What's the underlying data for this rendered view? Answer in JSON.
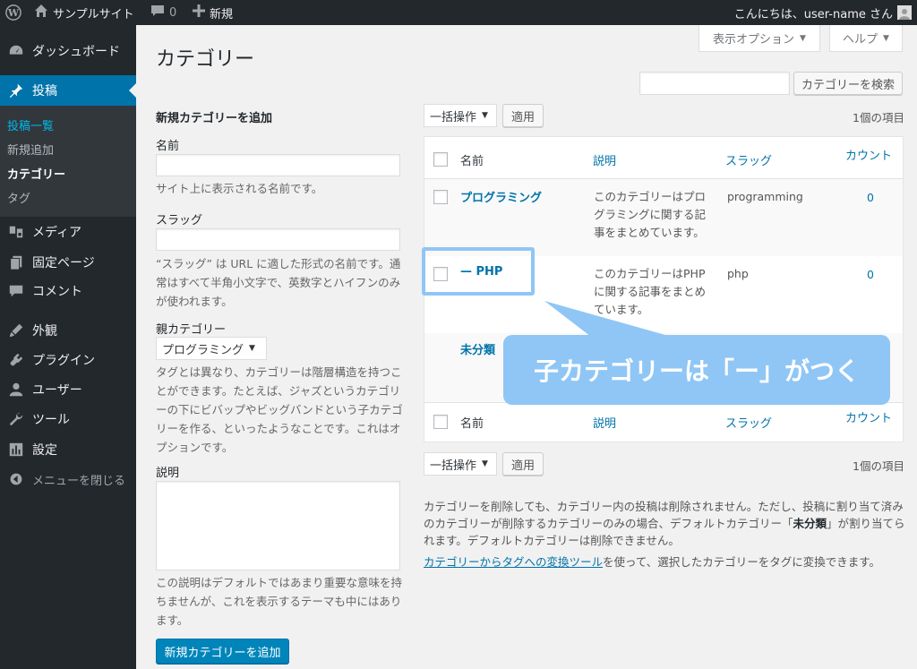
{
  "adminbar": {
    "site_name": "サンプルサイト",
    "comments_count": "0",
    "new_label": "新規",
    "greeting": "こんにちは、user-name さん"
  },
  "sidebar": {
    "items": [
      {
        "label": "ダッシュボード",
        "icon": "dashboard-icon"
      },
      {
        "label": "投稿",
        "icon": "pin-icon"
      },
      {
        "label": "メディア",
        "icon": "media-icon"
      },
      {
        "label": "固定ページ",
        "icon": "page-icon"
      },
      {
        "label": "コメント",
        "icon": "comment-icon"
      },
      {
        "label": "外観",
        "icon": "appearance-icon"
      },
      {
        "label": "プラグイン",
        "icon": "plugin-icon"
      },
      {
        "label": "ユーザー",
        "icon": "user-icon"
      },
      {
        "label": "ツール",
        "icon": "wrench-icon"
      },
      {
        "label": "設定",
        "icon": "settings-icon"
      },
      {
        "label": "メニューを閉じる",
        "icon": "collapse-icon"
      }
    ],
    "submenu": [
      "投稿一覧",
      "新規追加",
      "カテゴリー",
      "タグ"
    ]
  },
  "header": {
    "title": "カテゴリー",
    "screen_options": "表示オプション",
    "help": "ヘルプ"
  },
  "search": {
    "button": "カテゴリーを検索",
    "value": ""
  },
  "form": {
    "heading": "新規カテゴリーを追加",
    "name_label": "名前",
    "name_desc": "サイト上に表示される名前です。",
    "slug_label": "スラッグ",
    "slug_desc": "“スラッグ” は URL に適した形式の名前です。通常はすべて半角小文字で、英数字とハイフンのみが使われます。",
    "parent_label": "親カテゴリー",
    "parent_selected": "プログラミング",
    "parent_desc": "タグとは異なり、カテゴリーは階層構造を持つことができます。たとえば、ジャズというカテゴリーの下にビバップやビッグバンドという子カテゴリーを作る、といったようなことです。これはオプションです。",
    "desc_label": "説明",
    "desc_desc": "この説明はデフォルトではあまり重要な意味を持ちませんが、これを表示するテーマも中にはあります。",
    "submit": "新規カテゴリーを追加"
  },
  "bulk": {
    "selected": "一括操作",
    "apply": "適用",
    "items_count": "1個の項目"
  },
  "table": {
    "columns": [
      "名前",
      "説明",
      "スラッグ",
      "カウント"
    ],
    "rows": [
      {
        "name": "プログラミング",
        "desc": "このカテゴリーはプログラミングに関する記事をまとめています。",
        "slug": "programming",
        "count": "0"
      },
      {
        "name": "— PHP",
        "desc": "このカテゴリーはPHPに関する記事をまとめています。",
        "slug": "php",
        "count": "0"
      },
      {
        "name": "未分類",
        "desc": "",
        "slug": "",
        "count": ""
      }
    ]
  },
  "callout": {
    "text": "子カテゴリーは「ー」がつく"
  },
  "footer": {
    "note_pre": "カテゴリーを削除しても、カテゴリー内の投稿は削除されません。ただし、投稿に割り当て済みのカテゴリーが削除するカテゴリーのみの場合、デフォルトカテゴリー「",
    "note_bold": "未分類",
    "note_post": "」が割り当てられます。デフォルトカテゴリーは削除できません。",
    "link": "カテゴリーからタグへの変換ツール",
    "link_after": "を使って、選択したカテゴリーをタグに変換できます。"
  },
  "colors": {
    "accent": "#0073aa",
    "sidebar": "#23282d",
    "callout": "#8fc6f5"
  }
}
